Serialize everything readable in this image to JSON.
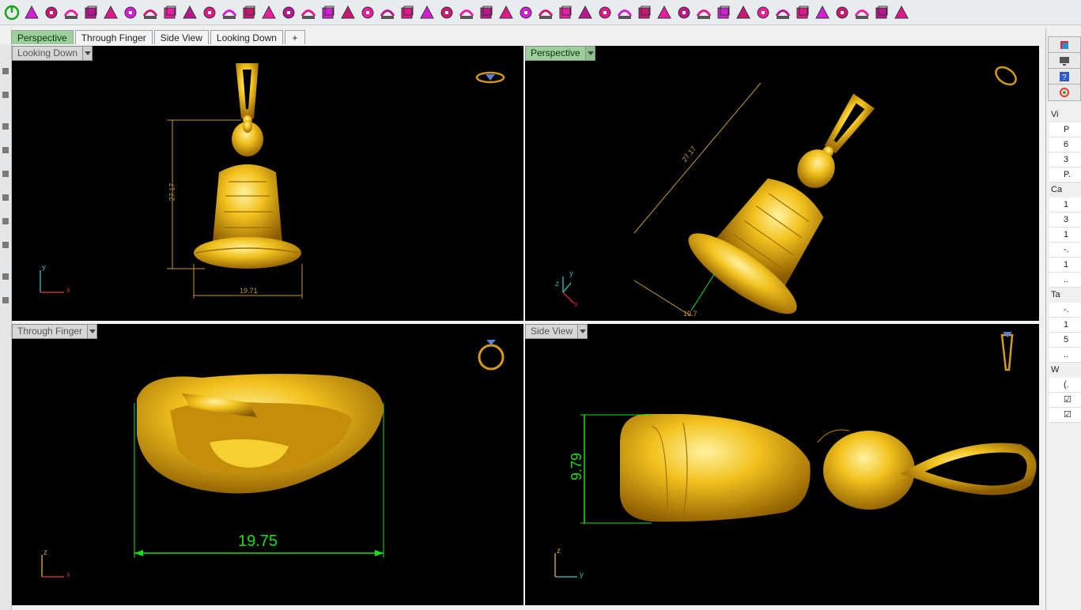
{
  "tabs": [
    {
      "label": "Perspective",
      "active": true
    },
    {
      "label": "Through Finger",
      "active": false
    },
    {
      "label": "Side View",
      "active": false
    },
    {
      "label": "Looking Down",
      "active": false
    },
    {
      "label": "+",
      "active": false
    }
  ],
  "viewports": {
    "top_left": {
      "label": "Looking Down",
      "active": false,
      "dim_vertical": "27.17",
      "dim_horizontal": "19.71",
      "axis_1": "y",
      "axis_2": "x"
    },
    "top_right": {
      "label": "Perspective",
      "active": true,
      "dim_long": "27.17",
      "dim_short": "19.7",
      "axis_1": "z",
      "axis_2": "y",
      "axis_3": "x"
    },
    "bottom_left": {
      "label": "Through Finger",
      "active": false,
      "dim_horizontal": "19.75",
      "axis_1": "z",
      "axis_2": "x"
    },
    "bottom_right": {
      "label": "Side View",
      "active": false,
      "dim_vertical": "9.79",
      "axis_1": "z",
      "axis_2": "y"
    }
  },
  "right_panel": {
    "rows": [
      {
        "text": "Vi",
        "type": "head"
      },
      {
        "text": "P",
        "type": "val"
      },
      {
        "text": "6",
        "type": "val"
      },
      {
        "text": "3",
        "type": "val"
      },
      {
        "text": "P.",
        "type": "val"
      },
      {
        "text": "Ca",
        "type": "head"
      },
      {
        "text": "1",
        "type": "val"
      },
      {
        "text": "3",
        "type": "val"
      },
      {
        "text": "1",
        "type": "val"
      },
      {
        "text": "-.",
        "type": "val"
      },
      {
        "text": "1",
        "type": "val"
      },
      {
        "text": "..",
        "type": "val"
      },
      {
        "text": "Ta",
        "type": "head"
      },
      {
        "text": "-.",
        "type": "val"
      },
      {
        "text": "1",
        "type": "val"
      },
      {
        "text": "5",
        "type": "val"
      },
      {
        "text": "..",
        "type": "val"
      },
      {
        "text": "W",
        "type": "head"
      },
      {
        "text": "(.",
        "type": "val"
      },
      {
        "text": "☑",
        "type": "val"
      },
      {
        "text": "☑",
        "type": "val"
      }
    ]
  },
  "colors": {
    "gold": "#e8b11a",
    "dim_gold": "#c59a2e",
    "dim_green": "#18e018",
    "tab_active": "#9ccf9c"
  }
}
